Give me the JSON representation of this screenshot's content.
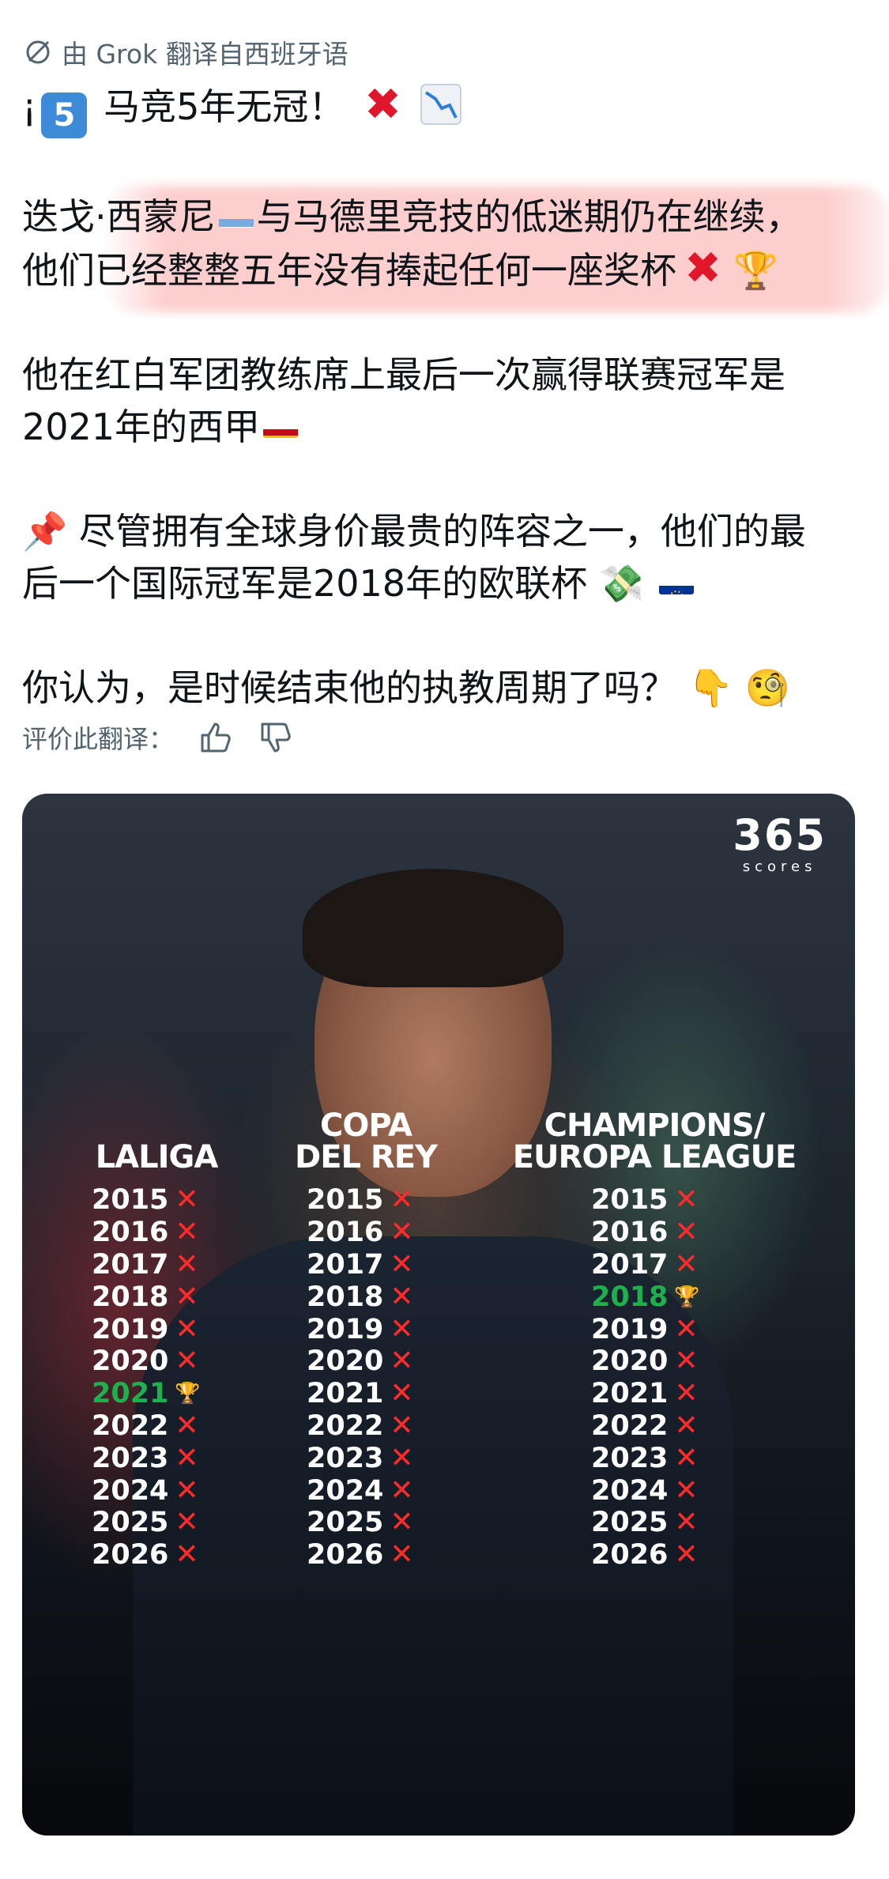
{
  "translation_note": "由 Grok 翻译自西班牙语",
  "post": {
    "headline": {
      "prefix": "¡",
      "keycap": "5",
      "text": "马竞5年无冠！"
    },
    "para1": {
      "line1": "迭戈·西蒙尼",
      "line1b": "与马德里竞技的低迷期仍在继续，",
      "line2": "他们已经整整五年没有捧起任何一座奖杯"
    },
    "para2": {
      "line1": "他在红白军团教练席上最后一次赢得联赛冠军是",
      "line2": "2021年的西甲"
    },
    "para3": {
      "line1": "尽管拥有全球身价最贵的阵容之一，他们的最",
      "line2": "后一个国际冠军是2018年的欧联杯"
    },
    "para4": {
      "line1": "你认为，是时候结束他的执教周期了吗？"
    }
  },
  "rate": {
    "label": "评价此翻译："
  },
  "image": {
    "logo_main": "365",
    "logo_sub": "scores",
    "columns": [
      {
        "header": [
          "LALIGA"
        ],
        "rows": [
          {
            "year": "2015",
            "result": "x"
          },
          {
            "year": "2016",
            "result": "x"
          },
          {
            "year": "2017",
            "result": "x"
          },
          {
            "year": "2018",
            "result": "x"
          },
          {
            "year": "2019",
            "result": "x"
          },
          {
            "year": "2020",
            "result": "x"
          },
          {
            "year": "2021",
            "result": "trophy"
          },
          {
            "year": "2022",
            "result": "x"
          },
          {
            "year": "2023",
            "result": "x"
          },
          {
            "year": "2024",
            "result": "x"
          },
          {
            "year": "2025",
            "result": "x"
          },
          {
            "year": "2026",
            "result": "x"
          }
        ]
      },
      {
        "header": [
          "COPA",
          "DEL REY"
        ],
        "rows": [
          {
            "year": "2015",
            "result": "x"
          },
          {
            "year": "2016",
            "result": "x"
          },
          {
            "year": "2017",
            "result": "x"
          },
          {
            "year": "2018",
            "result": "x"
          },
          {
            "year": "2019",
            "result": "x"
          },
          {
            "year": "2020",
            "result": "x"
          },
          {
            "year": "2021",
            "result": "x"
          },
          {
            "year": "2022",
            "result": "x"
          },
          {
            "year": "2023",
            "result": "x"
          },
          {
            "year": "2024",
            "result": "x"
          },
          {
            "year": "2025",
            "result": "x"
          },
          {
            "year": "2026",
            "result": "x"
          }
        ]
      },
      {
        "header": [
          "CHAMPIONS/",
          "EUROPA LEAGUE"
        ],
        "rows": [
          {
            "year": "2015",
            "result": "x"
          },
          {
            "year": "2016",
            "result": "x"
          },
          {
            "year": "2017",
            "result": "x"
          },
          {
            "year": "2018",
            "result": "trophy"
          },
          {
            "year": "2019",
            "result": "x"
          },
          {
            "year": "2020",
            "result": "x"
          },
          {
            "year": "2021",
            "result": "x"
          },
          {
            "year": "2022",
            "result": "x"
          },
          {
            "year": "2023",
            "result": "x"
          },
          {
            "year": "2024",
            "result": "x"
          },
          {
            "year": "2025",
            "result": "x"
          },
          {
            "year": "2026",
            "result": "x"
          }
        ]
      }
    ]
  },
  "colors": {
    "win": "#1fb04e",
    "loss": "#ff2a2a",
    "muted": "#536471"
  }
}
